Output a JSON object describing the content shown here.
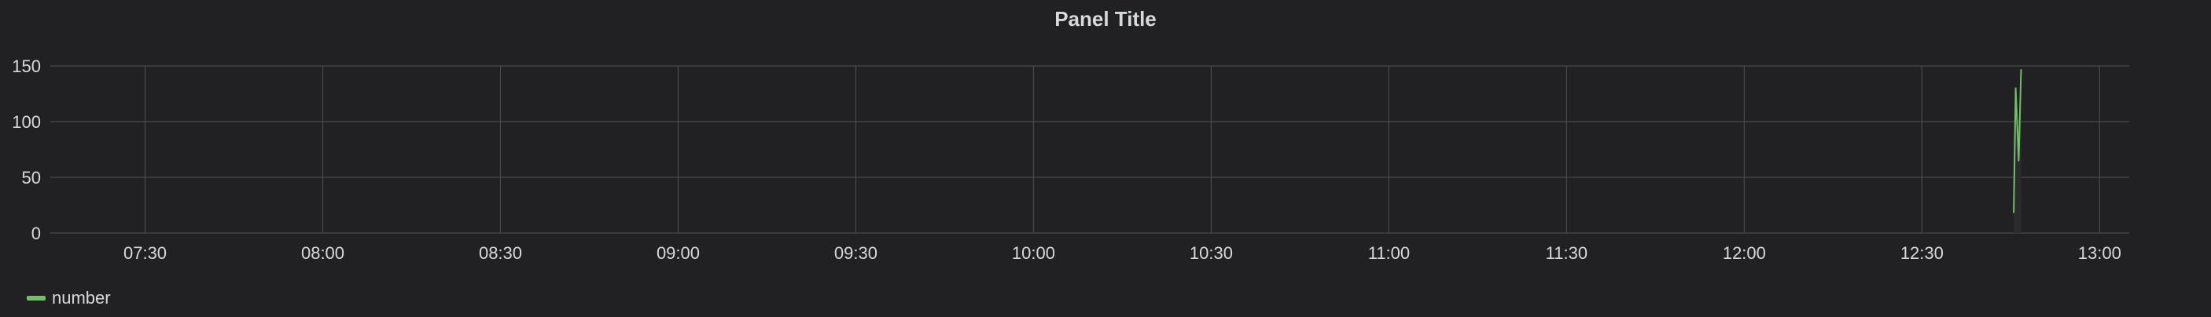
{
  "panel": {
    "title": "Panel Title"
  },
  "colors": {
    "background": "#212124",
    "grid": "#4a4a4e",
    "text": "#d8d9da",
    "series": "#73bf69"
  },
  "chart_data": {
    "type": "line",
    "title": "Panel Title",
    "xlabel": "",
    "ylabel": "",
    "x_ticks": [
      "07:30",
      "08:00",
      "08:30",
      "09:00",
      "09:30",
      "10:00",
      "10:30",
      "11:00",
      "11:30",
      "12:00",
      "12:30",
      "13:00"
    ],
    "y_ticks": [
      0,
      50,
      100,
      150
    ],
    "xlim": [
      "07:14",
      "13:05"
    ],
    "ylim": [
      0,
      150
    ],
    "grid": true,
    "legend": "bottom-left",
    "series": [
      {
        "name": "number",
        "color": "#73bf69",
        "x": [
          "12:45:30",
          "12:45:50",
          "12:46:20",
          "12:46:45"
        ],
        "y": [
          18,
          130,
          65,
          147
        ]
      }
    ]
  }
}
